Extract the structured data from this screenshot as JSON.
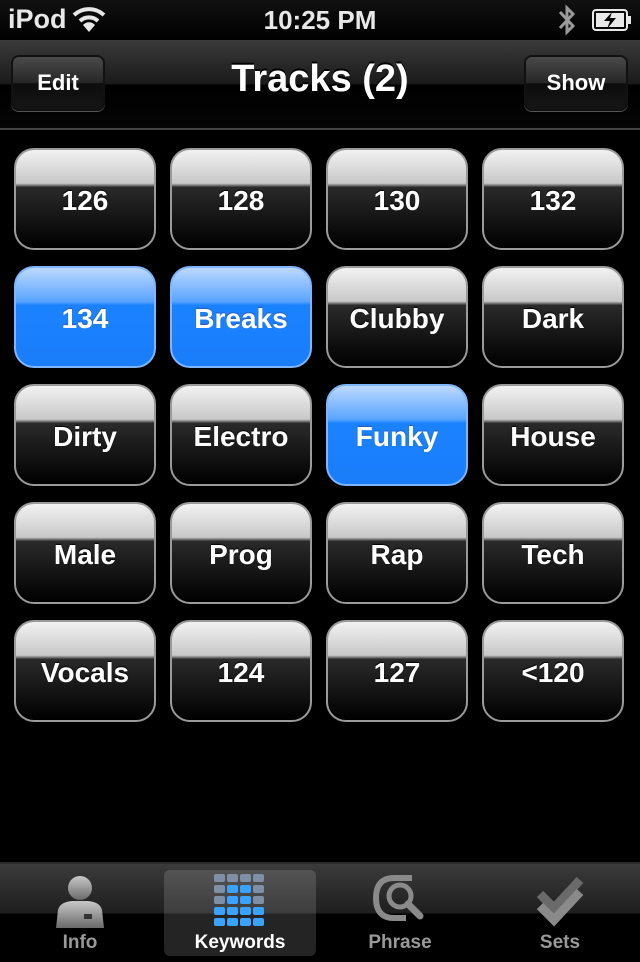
{
  "status_bar": {
    "carrier": "iPod",
    "time": "10:25 PM",
    "icons": [
      "wifi-icon",
      "bluetooth-icon",
      "battery-charging-icon"
    ]
  },
  "nav": {
    "title": "Tracks (2)",
    "left_button": "Edit",
    "right_button": "Show"
  },
  "keywords": [
    {
      "label": "126",
      "selected": false
    },
    {
      "label": "128",
      "selected": false
    },
    {
      "label": "130",
      "selected": false
    },
    {
      "label": "132",
      "selected": false
    },
    {
      "label": "134",
      "selected": true
    },
    {
      "label": "Breaks",
      "selected": true
    },
    {
      "label": "Clubby",
      "selected": false
    },
    {
      "label": "Dark",
      "selected": false
    },
    {
      "label": "Dirty",
      "selected": false
    },
    {
      "label": "Electro",
      "selected": false
    },
    {
      "label": "Funky",
      "selected": true
    },
    {
      "label": "House",
      "selected": false
    },
    {
      "label": "Male",
      "selected": false
    },
    {
      "label": "Prog",
      "selected": false
    },
    {
      "label": "Rap",
      "selected": false
    },
    {
      "label": "Tech",
      "selected": false
    },
    {
      "label": "Vocals",
      "selected": false
    },
    {
      "label": "124",
      "selected": false
    },
    {
      "label": "127",
      "selected": false
    },
    {
      "label": "<120",
      "selected": false
    }
  ],
  "tabs": [
    {
      "label": "Info",
      "icon": "person-icon",
      "active": false
    },
    {
      "label": "Keywords",
      "icon": "keyword-grid-icon",
      "active": true
    },
    {
      "label": "Phrase",
      "icon": "search-phrase-icon",
      "active": false
    },
    {
      "label": "Sets",
      "icon": "checkmarks-icon",
      "active": false
    }
  ],
  "colors": {
    "selected_blue": "#1b82ff",
    "background": "#000000"
  }
}
